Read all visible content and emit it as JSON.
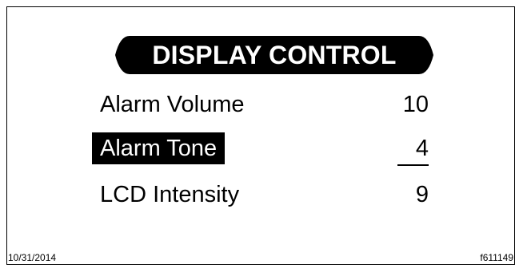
{
  "screen": {
    "title": "DISPLAY CONTROL",
    "items": [
      {
        "label": "Alarm Volume",
        "value": "10",
        "selected": false
      },
      {
        "label": "Alarm Tone",
        "value": "4",
        "selected": true
      },
      {
        "label": "LCD Intensity",
        "value": "9",
        "selected": false
      }
    ]
  },
  "footer": {
    "date": "10/31/2014",
    "figure_id": "f611149"
  },
  "colors": {
    "foreground": "#000000",
    "background": "#ffffff",
    "highlight_bg": "#000000",
    "highlight_text": "#ffffff"
  }
}
